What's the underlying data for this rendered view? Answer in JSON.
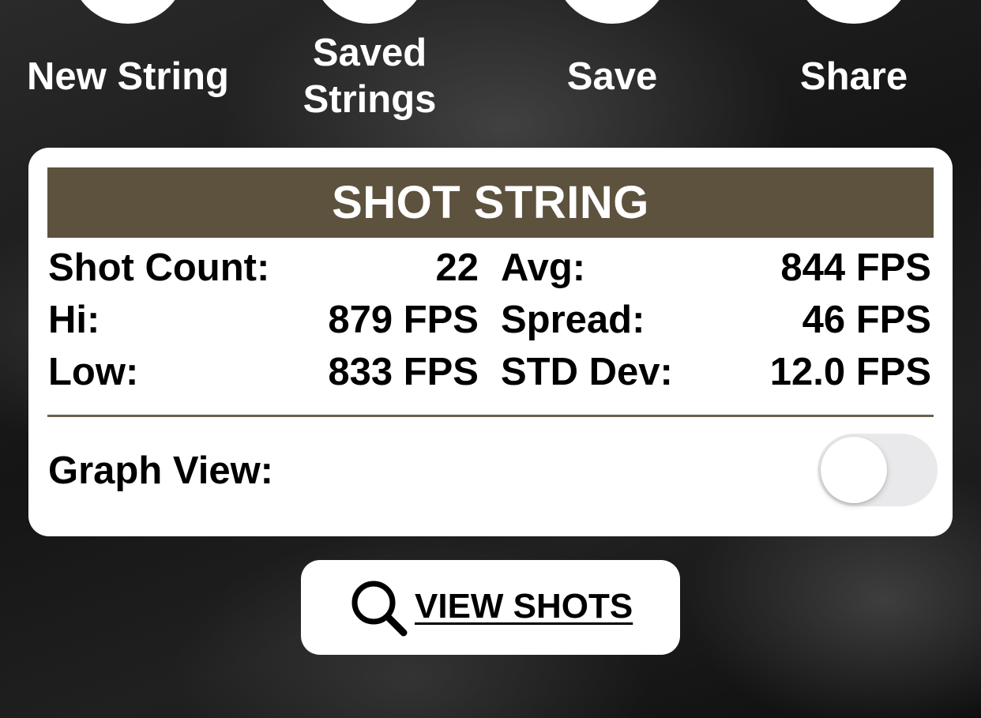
{
  "actions": {
    "new_string": "New String",
    "saved_strings": "Saved\nStrings",
    "save": "Save",
    "share": "Share"
  },
  "shot_string": {
    "title": "SHOT STRING",
    "stats": {
      "shot_count_label": "Shot Count:",
      "shot_count_value": "22",
      "avg_label": "Avg:",
      "avg_value": "844 FPS",
      "hi_label": "Hi:",
      "hi_value": "879 FPS",
      "spread_label": "Spread:",
      "spread_value": "46 FPS",
      "low_label": "Low:",
      "low_value": "833 FPS",
      "std_dev_label": "STD Dev:",
      "std_dev_value": "12.0 FPS"
    },
    "graph_view_label": "Graph View:",
    "graph_view_enabled": false
  },
  "view_shots": {
    "label": "VIEW SHOTS",
    "icon": "search-icon"
  },
  "colors": {
    "header_bg": "#5d523e",
    "divider": "#6b604d",
    "toggle_off": "#e9e9eb"
  }
}
